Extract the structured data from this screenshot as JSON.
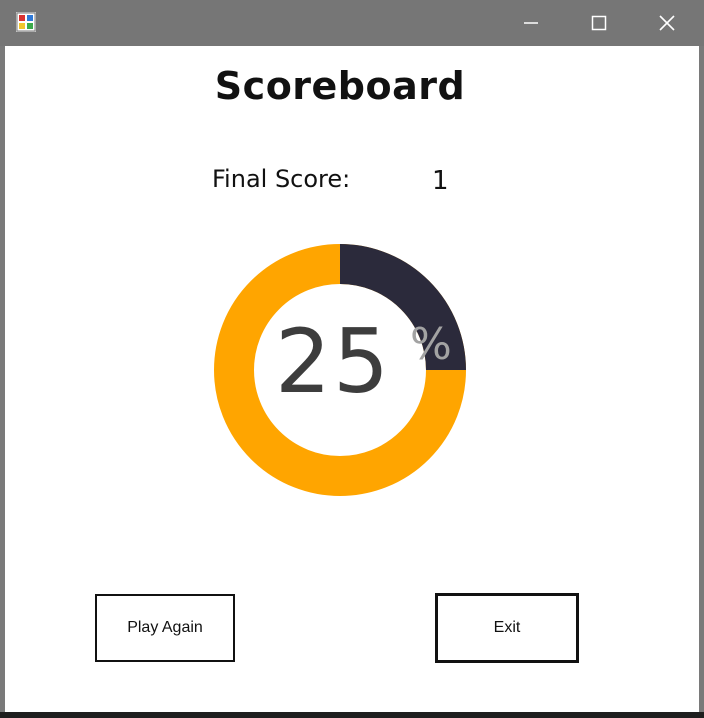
{
  "window": {
    "icon": "app-icon",
    "controls": {
      "minimize_icon": "minimize-icon",
      "maximize_icon": "maximize-icon",
      "close_icon": "close-icon"
    }
  },
  "scoreboard": {
    "title": "Scoreboard",
    "final_score_label": "Final Score:",
    "final_score_value": "1"
  },
  "progress": {
    "value": 25,
    "display_value": "25",
    "unit": "%",
    "fill_fraction": 0.25,
    "colors": {
      "filled": "#2b2a3b",
      "remaining": "#ffa500"
    }
  },
  "buttons": {
    "play_again_label": "Play Again",
    "exit_label": "Exit"
  },
  "colors": {
    "titlebar": "#767676",
    "client_background": "#ffffff",
    "text": "#111111"
  }
}
